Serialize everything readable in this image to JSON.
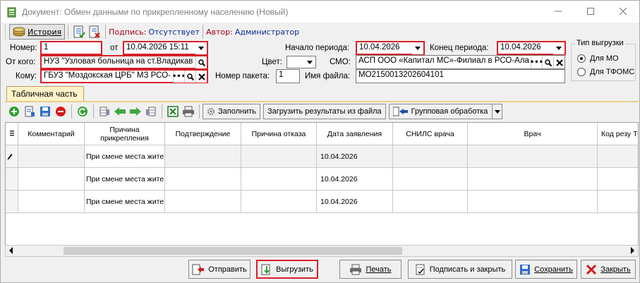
{
  "window": {
    "title": "Документ: Обмен данными по прикрепленному населению (Новый)"
  },
  "toolbar": {
    "history_label": "История",
    "signature_label": "Подпись:",
    "signature_value": "Отсутствует",
    "author_label": "Автор:",
    "author_value": "Администратор"
  },
  "form": {
    "number_label": "Номер:",
    "number_value": "1",
    "from_date_label": "от",
    "from_date_value": "10.04.2026 15:11",
    "period_start_label": "Начало периода:",
    "period_start_value": "10.04.2026",
    "period_end_label": "Конец периода:",
    "period_end_value": "10.04.2026",
    "from_whom_label": "От кого:",
    "from_whom_value": "НУЗ \"Узловая больница на ст.Владикав",
    "color_label": "Цвет:",
    "smo_label": "СМО:",
    "smo_value": "АСП ООО «Капитал МС»-Филиал в РСО-Ала",
    "to_whom_label": "Кому:",
    "to_whom_value": "ГБУЗ \"Моздокская ЦРБ\" МЗ РСО-",
    "packet_label": "Номер пакета:",
    "packet_value": "1",
    "filename_label": "Имя файла:",
    "filename_value": "MO2150013202604101"
  },
  "export_type": {
    "title": "Тип выгрузки",
    "options": [
      "Для МО",
      "Для ТФОМС"
    ],
    "selected": "Для МО"
  },
  "tab": {
    "label": "Табличная часть"
  },
  "table_toolbar": {
    "fill_label": "Заполнить",
    "load_results_label": "Загрузить результаты из файла",
    "group_label": "Групповая обработка"
  },
  "table": {
    "columns": [
      "Комментарий",
      "Причина прикрепления",
      "Подтверждение",
      "Причина отказа",
      "Дата заявления",
      "СНИЛС врача",
      "Врач",
      "Код резу ТФО"
    ],
    "rows": [
      {
        "reason": "При смене места жите",
        "date": "10.04.2026"
      },
      {
        "reason": "При смене места жите",
        "date": "10.04.2026"
      },
      {
        "reason": "При смене места жите",
        "date": "10.04.2026"
      }
    ]
  },
  "buttons": {
    "send": "Отправить",
    "export": "Выгрузить",
    "print": "Печать",
    "sign_close": "Подписать и закрыть",
    "save": "Сохранить",
    "close": "Закрыть"
  },
  "colors": {
    "highlight_red": "#d9202a",
    "tab_bg": "#fff3c8",
    "link_blue": "#0b2d8f",
    "author_red": "#a0001c"
  }
}
